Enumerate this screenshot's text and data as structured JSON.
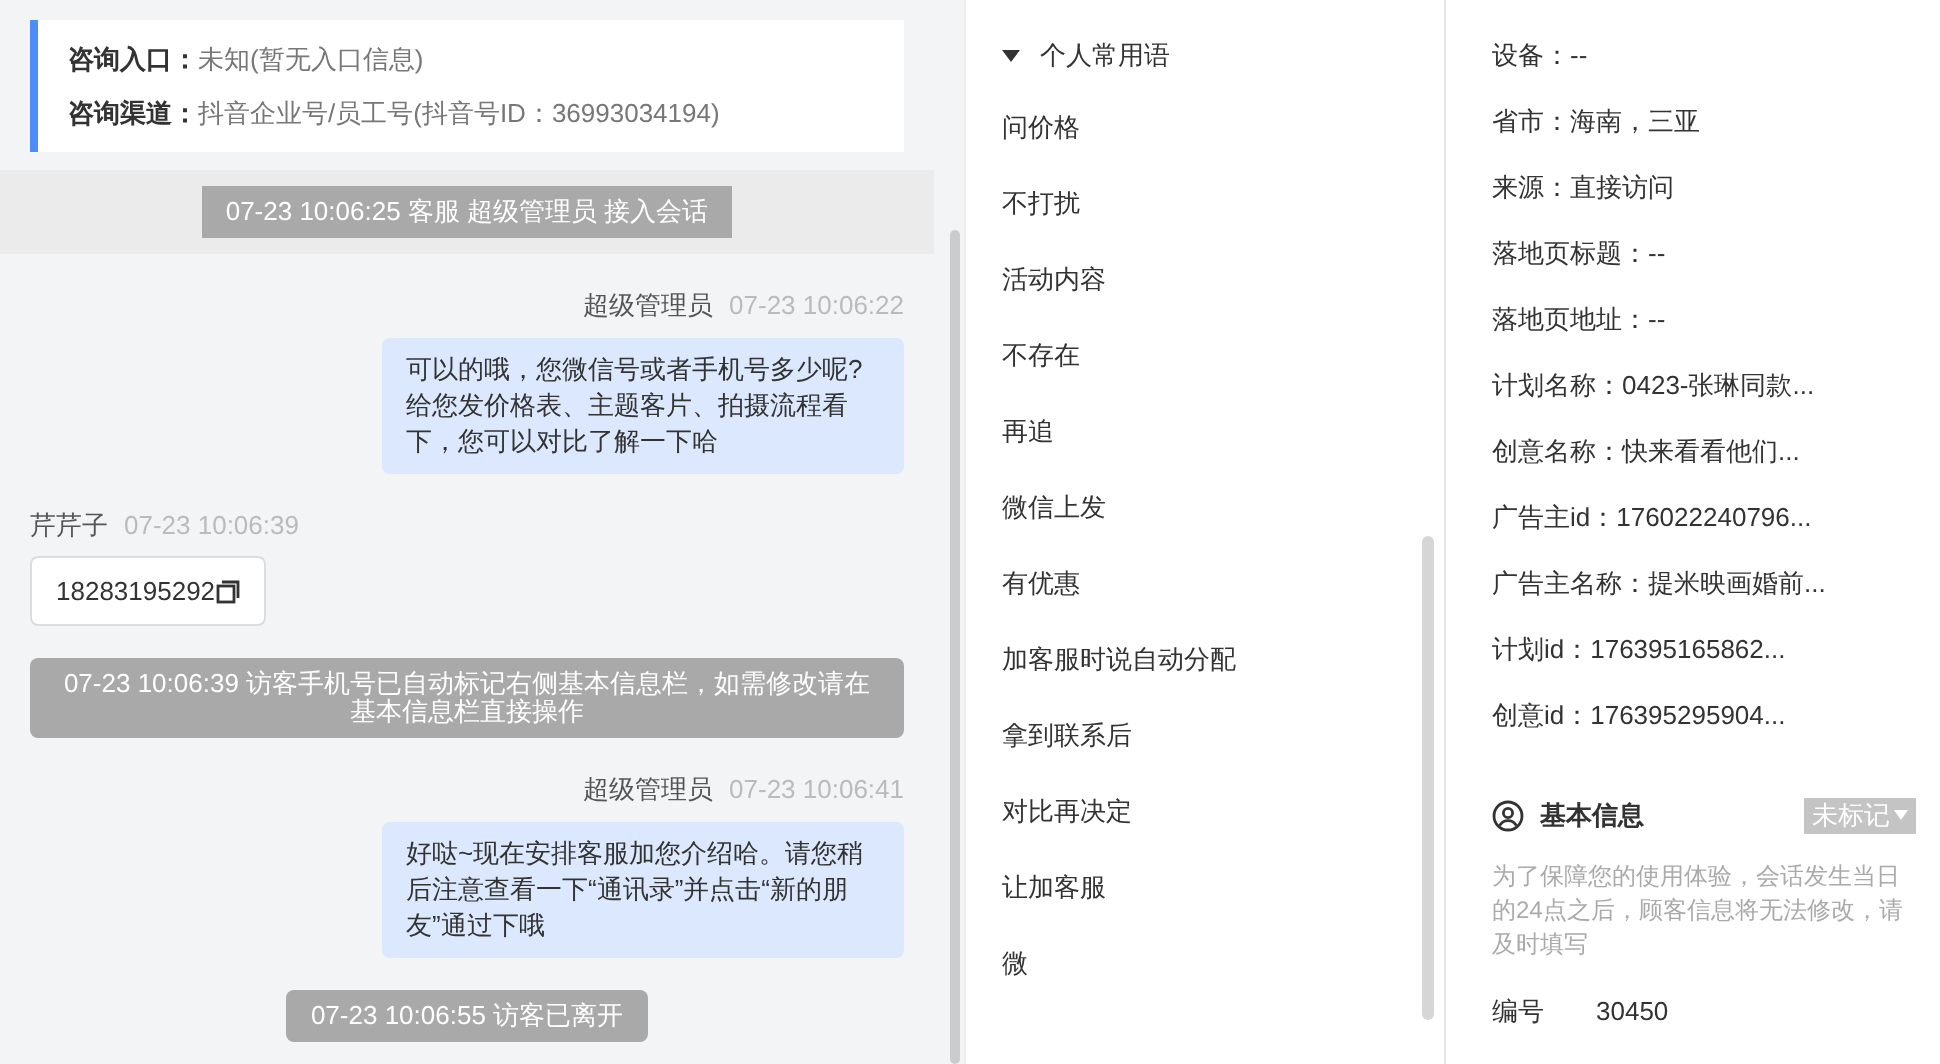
{
  "consult_info": [
    {
      "label": "咨询入口：",
      "value": "未知(暂无入口信息)"
    },
    {
      "label": "咨询渠道：",
      "value": "抖音企业号/员工号(抖音号ID：36993034194)"
    }
  ],
  "messages": [
    {
      "kind": "system",
      "text": "07-23 10:06:25 客服 超级管理员 接入会话",
      "banner": true
    },
    {
      "kind": "agent",
      "sender": "超级管理员",
      "time": "07-23 10:06:22",
      "text": "可以的哦，您微信号或者手机号多少呢?给您发价格表、主题客片、拍摄流程看下，您可以对比了解一下哈"
    },
    {
      "kind": "visitor",
      "sender": "芹芹子",
      "time": "07-23 10:06:39",
      "text": "18283195292"
    },
    {
      "kind": "system",
      "text": "07-23 10:06:39 访客手机号已自动标记右侧基本信息栏，如需修改请在基本信息栏直接操作",
      "banner": false
    },
    {
      "kind": "agent",
      "sender": "超级管理员",
      "time": "07-23 10:06:41",
      "text": "好哒~现在安排客服加您介绍哈。请您稍后注意查看一下“通讯录”并点击“新的朋友”通过下哦"
    },
    {
      "kind": "system",
      "text": "07-23 10:06:55 访客已离开",
      "banner": false
    }
  ],
  "phrases": {
    "title": "个人常用语",
    "expanded": true,
    "items": [
      "问价格",
      "不打扰",
      "活动内容",
      "不存在",
      "再追",
      "微信上发",
      "有优惠",
      "加客服时说自动分配",
      "拿到联系后",
      "对比再决定",
      "让加客服",
      "微"
    ]
  },
  "visitor_details": [
    "设备：--",
    "省市：海南，三亚",
    "来源：直接访问",
    "落地页标题：--",
    "落地页地址：--",
    "计划名称：0423-张琳同款...",
    "创意名称：快来看看他们...",
    "广告主id：176022240796...",
    "广告主名称：提米映画婚前...",
    "计划id：176395165862...",
    "创意id：176395295904..."
  ],
  "basic_info": {
    "title": "基本信息",
    "tag": "未标记",
    "note": "为了保障您的使用体验，会话发生当日的24点之后，顾客信息将无法修改，请及时填写",
    "fields": [
      {
        "label": "编号",
        "value": "30450"
      }
    ]
  }
}
